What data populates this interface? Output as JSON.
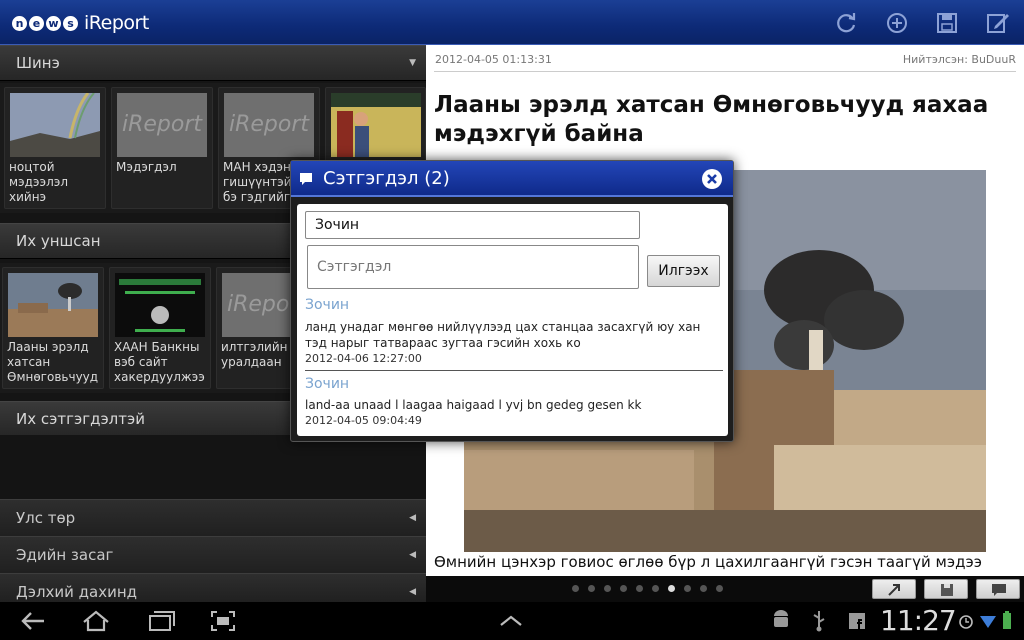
{
  "app": {
    "logo_news": "news",
    "logo_ireport": "iReport"
  },
  "toolbar": {
    "icons": [
      "refresh-icon",
      "add-icon",
      "save-icon",
      "edit-icon"
    ]
  },
  "sections": {
    "new": {
      "title": "Шинэ",
      "items": [
        {
          "caption": "ноцтой мэдээлэл хийнэ"
        },
        {
          "caption": "Мэдэгдэл",
          "placeholder": "iReport"
        },
        {
          "caption": "МАН хэдэн гишүүнтэй юм бэ гэдгийг",
          "placeholder": "iReport"
        },
        {
          "caption": ""
        }
      ]
    },
    "popular": {
      "title": "Их уншсан",
      "items": [
        {
          "caption": "Лааны эрэлд хатсан Өмнөговьчууд"
        },
        {
          "caption": "ХААН Банкны вэб сайт хакердуулжээ"
        },
        {
          "caption": "илтгэлийн уралдаан",
          "placeholder": "iReport"
        }
      ]
    },
    "most_commented": {
      "title": "Их сэтгэгдэлтэй"
    },
    "categories": [
      {
        "title": "Улс төр"
      },
      {
        "title": "Эдийн засаг"
      },
      {
        "title": "Дэлхий дахинд"
      }
    ]
  },
  "article": {
    "date": "2012-04-05 01:13:31",
    "author": "Нийтэлсэн: BuDuuR",
    "title": "Лааны эрэлд хатсан Өмнөговьчууд яахаа мэдэхгүй байна",
    "body": "Өмнийн цэнхэр говиос өглөө бүр л цахилгаангүй гэсэн таагүй мэдээ"
  },
  "pager": {
    "dots": 10,
    "active_index": 6
  },
  "dialog": {
    "title": "Сэтгэгдэл (2)",
    "name_value": "Зочин",
    "comment_placeholder": "Сэтгэгдэл",
    "send_label": "Илгээх",
    "comments": [
      {
        "author": "Зочин",
        "text": "ланд унадаг мөнгөө нийлүүлээд цах станцаа засахгүй юу хан тэд нарыг татвараас зугтаа гэсийн хохь ко",
        "date": "2012-04-06 12:27:00"
      },
      {
        "author": "Зочин",
        "text": "land-aa unaad l laagaa haigaad l yvj bn gedeg gesen kk",
        "date": "2012-04-05 09:04:49"
      }
    ]
  },
  "system": {
    "time": "11:27"
  },
  "colors": {
    "header": "#0d2a77",
    "dialog_header": "#1a3ca8",
    "comment_author": "#7aa3cf"
  }
}
